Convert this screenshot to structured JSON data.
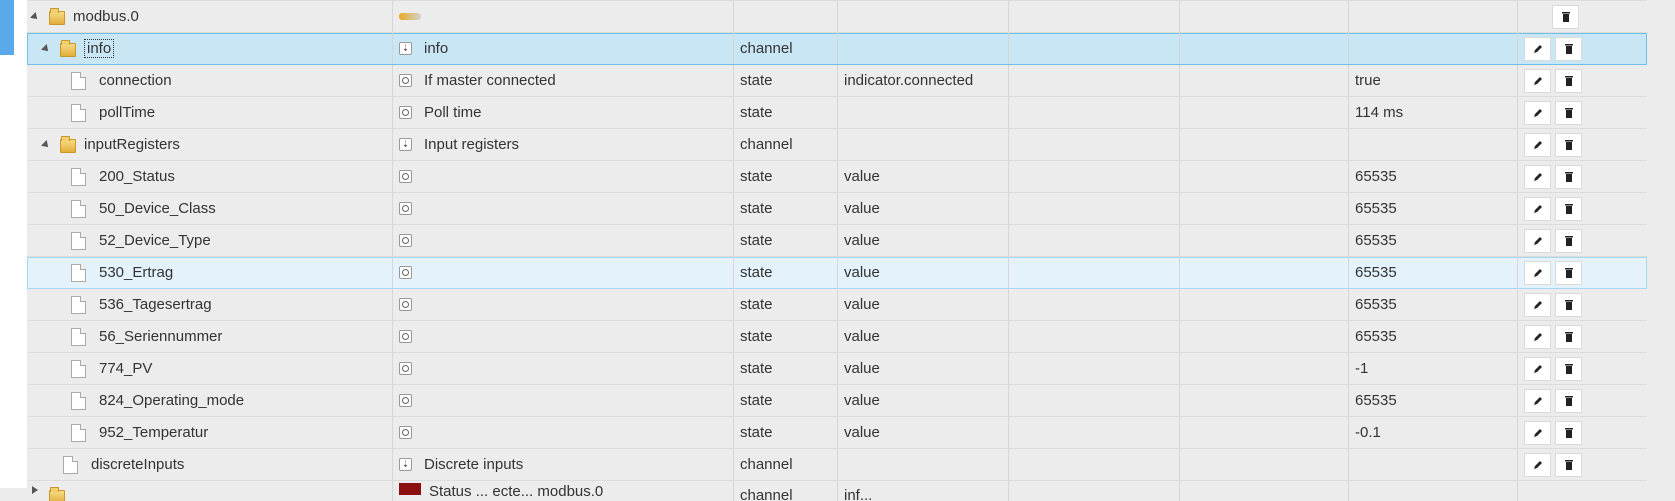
{
  "rows": [
    {
      "name": "",
      "label": "",
      "type": "",
      "role": "",
      "value": ""
    },
    {
      "name": "modbus.0",
      "label": "",
      "type": "",
      "role": "",
      "value": ""
    },
    {
      "name": "info",
      "label": "info",
      "type": "channel",
      "role": "",
      "value": ""
    },
    {
      "name": "connection",
      "label": "If master connected",
      "type": "state",
      "role": "indicator.connected",
      "value": "true"
    },
    {
      "name": "pollTime",
      "label": "Poll time",
      "type": "state",
      "role": "",
      "value": "114 ms"
    },
    {
      "name": "inputRegisters",
      "label": "Input registers",
      "type": "channel",
      "role": "",
      "value": ""
    },
    {
      "name": "200_Status",
      "label": "",
      "type": "state",
      "role": "value",
      "value": "65535"
    },
    {
      "name": "50_Device_Class",
      "label": "",
      "type": "state",
      "role": "value",
      "value": "65535"
    },
    {
      "name": "52_Device_Type",
      "label": "",
      "type": "state",
      "role": "value",
      "value": "65535"
    },
    {
      "name": "530_Ertrag",
      "label": "",
      "type": "state",
      "role": "value",
      "value": "65535"
    },
    {
      "name": "536_Tagesertrag",
      "label": "",
      "type": "state",
      "role": "value",
      "value": "65535"
    },
    {
      "name": "56_Seriennummer",
      "label": "",
      "type": "state",
      "role": "value",
      "value": "65535"
    },
    {
      "name": "774_PV",
      "label": "",
      "type": "state",
      "role": "value",
      "value": "-1"
    },
    {
      "name": "824_Operating_mode",
      "label": "",
      "type": "state",
      "role": "value",
      "value": "65535"
    },
    {
      "name": "952_Temperatur",
      "label": "",
      "type": "state",
      "role": "value",
      "value": "-0.1"
    },
    {
      "name": "discreteInputs",
      "label": "Discrete inputs",
      "type": "channel",
      "role": "",
      "value": ""
    },
    {
      "name": "",
      "label": "Status ... ecte... modbus.0",
      "type": "channel",
      "role": "inf...",
      "value": ""
    }
  ],
  "colors": {
    "selected": "#c9e6f5",
    "hover": "#e3f2fb",
    "accent": "#5aa9ea",
    "background": "#ececec"
  },
  "icons": {
    "edit": "pencil-icon",
    "delete": "trash-icon",
    "expand": "triangle-expand-icon",
    "folder": "folder-icon",
    "state": "state-icon",
    "channel": "channel-icon"
  }
}
